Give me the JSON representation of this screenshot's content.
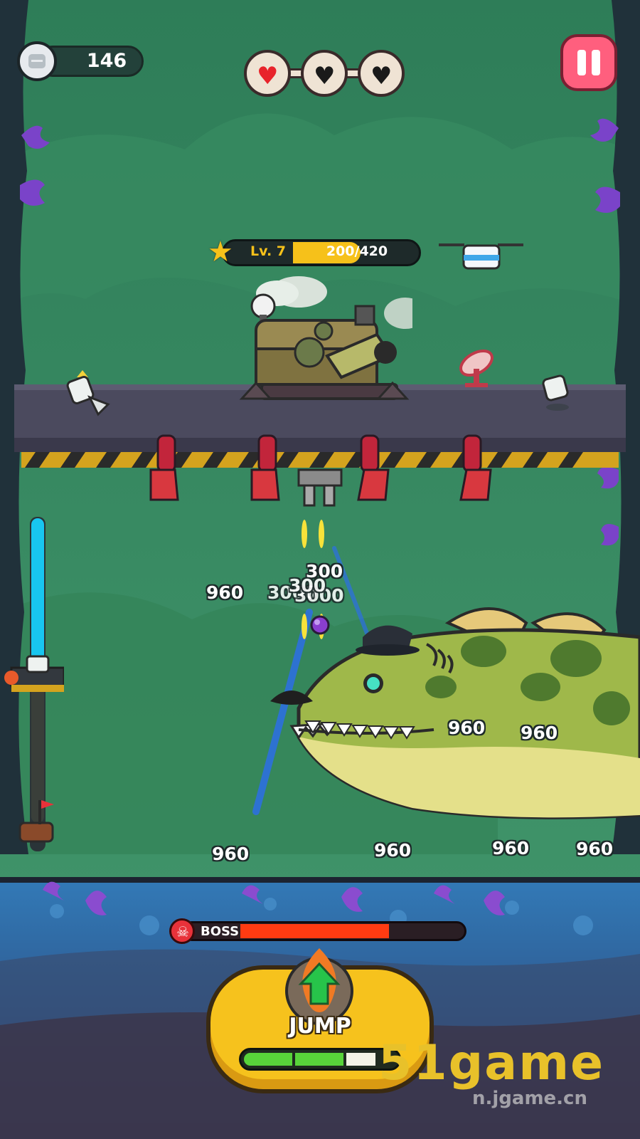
{
  "hud": {
    "coins": "146",
    "coin_icon": "robot-coin-icon",
    "lives": {
      "total": 3,
      "remaining": 1,
      "full_color": "#e8232b",
      "empty_color": "#1a1a1a"
    },
    "pause_icon": "pause-icon"
  },
  "level": {
    "label": "Lv. 7",
    "progress_text": "200/420",
    "progress": 0.476
  },
  "damage_numbers": [
    "960",
    "300",
    "3000",
    "3000",
    "300",
    "960",
    "960",
    "960",
    "960",
    "960",
    "960"
  ],
  "boss": {
    "label": "BOSS",
    "health": 0.72,
    "bar_color": "#ff3b12"
  },
  "jump": {
    "label": "JUMP",
    "charge_segments": [
      1,
      1,
      0.6
    ]
  },
  "watermark": {
    "primary": "51game",
    "secondary": "n.jgame.cn"
  },
  "colors": {
    "background": "#2f7f5b",
    "platform": "#4b4a5e",
    "button": "#f6c21d",
    "water": "#2a78b8"
  }
}
